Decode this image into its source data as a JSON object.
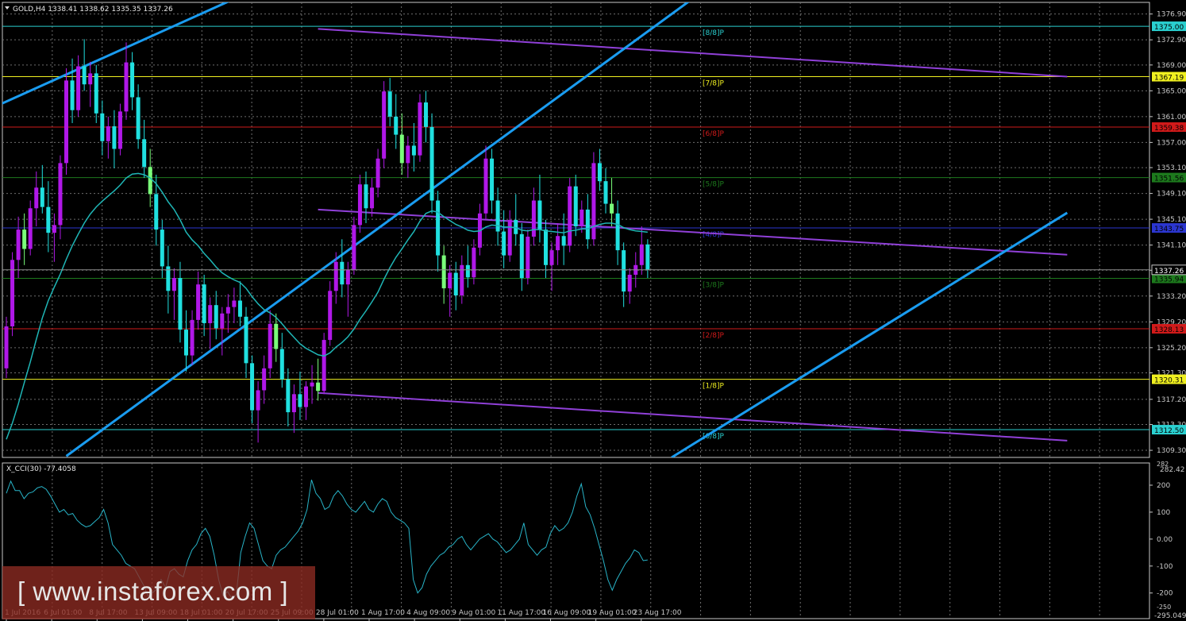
{
  "symbol_header": "GOLD,H4  1338.41 1338.62 1335.35 1337.26",
  "indicator_header": "X_CCI(30) -77.4058",
  "watermark": "[  www.instaforex.com  ]",
  "colors": {
    "background": "#000000",
    "grid": "#6e6e6e",
    "axis": "#c8c8c8",
    "bull": "#b018e8",
    "bear": "#20e0e0",
    "bear_highlight": "#7aff7a",
    "ma": "#1fb6b6",
    "trend": "#1a9cf0",
    "channel": "#9040d8",
    "cci": "#28b4c8"
  },
  "chart_data": [
    {
      "type": "candlestick",
      "symbol": "GOLD",
      "timeframe": "H4",
      "last_ohlc": {
        "open": 1338.41,
        "high": 1338.62,
        "low": 1335.35,
        "close": 1337.26
      },
      "ylim": [
        1308.2,
        1378.7
      ],
      "y_ticks": [
        "1376.90",
        "1372.90",
        "1369.00",
        "1365.00",
        "1361.00",
        "1357.00",
        "1353.10",
        "1349.10",
        "1345.10",
        "1341.10",
        "1337.20",
        "1333.20",
        "1329.20",
        "1325.20",
        "1321.30",
        "1317.20",
        "1313.30",
        "1309.30"
      ],
      "x_ticks": [
        "1 Jul 2016",
        "6 Jul 01:00",
        "8 Jul 17:00",
        "13 Jul 09:00",
        "18 Jul 01:00",
        "20 Jul 17:00",
        "25 Jul 09:00",
        "28 Jul 01:00",
        "1 Aug 17:00",
        "4 Aug 09:00",
        "9 Aug 01:00",
        "11 Aug 17:00",
        "16 Aug 09:00",
        "19 Aug 01:00",
        "23 Aug 17:00"
      ],
      "murrey_levels": [
        {
          "label": "[8/8]P",
          "value": 1375.0,
          "color": "#2ad0d0",
          "tag_text": "#000000"
        },
        {
          "label": "[7/8]P",
          "value": 1367.19,
          "color": "#f0f020",
          "tag_text": "#000000"
        },
        {
          "label": "[6/8]P",
          "value": 1359.38,
          "color": "#d01a1a",
          "tag_text": "#000000"
        },
        {
          "label": "[5/8]P",
          "value": 1351.56,
          "color": "#1d7a1d",
          "tag_text": "#000000"
        },
        {
          "label": "[4/8]P",
          "value": 1343.75,
          "color": "#2b36d0",
          "tag_text": "#000000"
        },
        {
          "label": "[3/8]P",
          "value": 1335.94,
          "color": "#1d7a1d",
          "tag_text": "#000000"
        },
        {
          "label": "[2/8]P",
          "value": 1328.13,
          "color": "#d01a1a",
          "tag_text": "#000000"
        },
        {
          "label": "[1/8]P",
          "value": 1320.31,
          "color": "#f0f020",
          "tag_text": "#000000"
        },
        {
          "label": "[0/8]P",
          "value": 1312.5,
          "color": "#2ad0d0",
          "tag_text": "#000000"
        }
      ],
      "current_price": 1337.26,
      "ma_period_note": "",
      "candles": [
        [
          1322.0,
          1330.0,
          1320.5,
          1328.5
        ],
        [
          1328.5,
          1340.0,
          1327.0,
          1338.8
        ],
        [
          1338.8,
          1345.5,
          1336.0,
          1343.5
        ],
        [
          1343.5,
          1346.0,
          1338.0,
          1340.5
        ],
        [
          1340.5,
          1348.0,
          1339.5,
          1346.8
        ],
        [
          1346.8,
          1352.5,
          1344.0,
          1350.0
        ],
        [
          1350.0,
          1353.5,
          1346.0,
          1347.0
        ],
        [
          1347.0,
          1351.0,
          1340.0,
          1343.0
        ],
        [
          1343.0,
          1346.0,
          1338.5,
          1344.2
        ],
        [
          1344.2,
          1355.0,
          1342.0,
          1353.8
        ],
        [
          1353.8,
          1368.5,
          1352.0,
          1366.6
        ],
        [
          1366.6,
          1370.0,
          1360.0,
          1362.0
        ],
        [
          1362.0,
          1370.5,
          1361.0,
          1368.8
        ],
        [
          1368.8,
          1373.0,
          1365.0,
          1366.0
        ],
        [
          1366.0,
          1369.5,
          1362.5,
          1367.7
        ],
        [
          1367.7,
          1369.0,
          1360.0,
          1361.5
        ],
        [
          1361.5,
          1363.5,
          1355.0,
          1357.2
        ],
        [
          1357.2,
          1361.0,
          1354.5,
          1359.5
        ],
        [
          1359.5,
          1362.0,
          1353.0,
          1356.0
        ],
        [
          1356.0,
          1363.0,
          1355.0,
          1361.8
        ],
        [
          1361.8,
          1372.5,
          1360.5,
          1369.4
        ],
        [
          1369.4,
          1371.0,
          1362.0,
          1364.0
        ],
        [
          1364.0,
          1366.0,
          1356.0,
          1357.5
        ],
        [
          1357.5,
          1360.5,
          1351.5,
          1353.2
        ],
        [
          1353.2,
          1356.0,
          1347.0,
          1349.0
        ],
        [
          1349.0,
          1352.0,
          1341.0,
          1343.5
        ],
        [
          1343.5,
          1345.0,
          1336.0,
          1337.8
        ],
        [
          1337.8,
          1341.0,
          1330.5,
          1334.0
        ],
        [
          1334.0,
          1337.5,
          1329.5,
          1336.0
        ],
        [
          1336.0,
          1338.5,
          1326.0,
          1328.0
        ],
        [
          1328.0,
          1331.0,
          1321.5,
          1324.0
        ],
        [
          1324.0,
          1331.0,
          1322.5,
          1329.5
        ],
        [
          1329.5,
          1337.0,
          1328.0,
          1335.0
        ],
        [
          1335.0,
          1336.5,
          1327.0,
          1329.0
        ],
        [
          1329.0,
          1333.0,
          1325.0,
          1331.8
        ],
        [
          1331.8,
          1334.0,
          1326.5,
          1328.2
        ],
        [
          1328.2,
          1331.5,
          1324.0,
          1330.5
        ],
        [
          1330.5,
          1333.5,
          1327.5,
          1331.5
        ],
        [
          1331.5,
          1334.5,
          1329.0,
          1332.5
        ],
        [
          1332.5,
          1335.5,
          1328.5,
          1330.0
        ],
        [
          1330.0,
          1331.5,
          1320.5,
          1322.8
        ],
        [
          1322.8,
          1324.0,
          1313.5,
          1315.5
        ],
        [
          1315.5,
          1320.0,
          1310.5,
          1318.6
        ],
        [
          1318.6,
          1324.0,
          1316.5,
          1322.0
        ],
        [
          1322.0,
          1331.0,
          1320.5,
          1328.9
        ],
        [
          1328.9,
          1330.5,
          1323.0,
          1325.0
        ],
        [
          1325.0,
          1327.5,
          1319.0,
          1320.3
        ],
        [
          1320.3,
          1322.0,
          1313.0,
          1315.2
        ],
        [
          1315.2,
          1319.5,
          1312.0,
          1318.0
        ],
        [
          1318.0,
          1321.5,
          1314.0,
          1316.0
        ],
        [
          1316.0,
          1320.0,
          1314.0,
          1319.2
        ],
        [
          1319.2,
          1322.5,
          1316.5,
          1319.8
        ],
        [
          1319.8,
          1323.5,
          1317.0,
          1318.5
        ],
        [
          1318.5,
          1327.5,
          1318.0,
          1326.4
        ],
        [
          1326.4,
          1335.5,
          1325.5,
          1334.0
        ],
        [
          1334.0,
          1340.0,
          1332.0,
          1338.5
        ],
        [
          1338.5,
          1342.0,
          1333.0,
          1335.0
        ],
        [
          1335.0,
          1338.5,
          1330.0,
          1337.3
        ],
        [
          1337.3,
          1345.5,
          1336.5,
          1344.2
        ],
        [
          1344.2,
          1352.0,
          1343.0,
          1350.5
        ],
        [
          1350.5,
          1352.5,
          1344.5,
          1346.8
        ],
        [
          1346.8,
          1351.5,
          1345.5,
          1350.0
        ],
        [
          1350.0,
          1356.0,
          1348.5,
          1354.5
        ],
        [
          1354.5,
          1366.5,
          1353.0,
          1364.9
        ],
        [
          1364.9,
          1367.0,
          1359.5,
          1361.0
        ],
        [
          1361.0,
          1364.5,
          1356.0,
          1358.2
        ],
        [
          1358.2,
          1361.5,
          1352.0,
          1353.8
        ],
        [
          1353.8,
          1358.0,
          1351.5,
          1356.5
        ],
        [
          1356.5,
          1360.0,
          1352.5,
          1355.0
        ],
        [
          1355.0,
          1364.5,
          1354.0,
          1363.2
        ],
        [
          1363.2,
          1365.0,
          1357.0,
          1359.4
        ],
        [
          1359.4,
          1361.5,
          1346.0,
          1348.0
        ],
        [
          1348.0,
          1349.5,
          1337.0,
          1339.5
        ],
        [
          1339.5,
          1341.0,
          1332.0,
          1334.4
        ],
        [
          1334.4,
          1338.0,
          1330.0,
          1336.8
        ],
        [
          1336.8,
          1338.5,
          1331.0,
          1333.3
        ],
        [
          1333.3,
          1339.5,
          1332.0,
          1338.0
        ],
        [
          1338.0,
          1341.0,
          1334.5,
          1336.1
        ],
        [
          1336.1,
          1342.0,
          1335.0,
          1340.7
        ],
        [
          1340.7,
          1347.5,
          1339.5,
          1346.0
        ],
        [
          1346.0,
          1356.5,
          1345.0,
          1354.5
        ],
        [
          1354.5,
          1356.0,
          1346.0,
          1348.0
        ],
        [
          1348.0,
          1350.0,
          1341.0,
          1343.2
        ],
        [
          1343.2,
          1346.5,
          1337.5,
          1339.5
        ],
        [
          1339.5,
          1346.5,
          1338.5,
          1345.0
        ],
        [
          1345.0,
          1349.0,
          1341.0,
          1342.8
        ],
        [
          1342.8,
          1344.5,
          1334.0,
          1336.0
        ],
        [
          1336.0,
          1343.5,
          1335.0,
          1342.4
        ],
        [
          1342.4,
          1350.0,
          1341.0,
          1348.0
        ],
        [
          1348.0,
          1352.0,
          1341.5,
          1343.5
        ],
        [
          1343.5,
          1345.0,
          1336.0,
          1338.0
        ],
        [
          1338.0,
          1341.5,
          1334.0,
          1340.3
        ],
        [
          1340.3,
          1344.5,
          1338.0,
          1342.5
        ],
        [
          1342.5,
          1346.0,
          1338.0,
          1341.0
        ],
        [
          1341.0,
          1351.5,
          1340.0,
          1350.2
        ],
        [
          1350.2,
          1352.0,
          1342.5,
          1344.0
        ],
        [
          1344.0,
          1348.0,
          1343.0,
          1346.6
        ],
        [
          1346.6,
          1349.0,
          1340.5,
          1342.0
        ],
        [
          1342.0,
          1355.5,
          1341.0,
          1353.8
        ],
        [
          1353.8,
          1356.0,
          1349.5,
          1351.0
        ],
        [
          1351.0,
          1353.0,
          1346.0,
          1347.5
        ],
        [
          1347.5,
          1351.5,
          1344.0,
          1346.0
        ],
        [
          1346.0,
          1348.0,
          1338.0,
          1340.3
        ],
        [
          1340.3,
          1341.5,
          1331.5,
          1333.9
        ],
        [
          1333.9,
          1337.5,
          1332.0,
          1336.5
        ],
        [
          1336.5,
          1340.0,
          1334.5,
          1338.0
        ],
        [
          1338.0,
          1344.0,
          1336.5,
          1341.2
        ],
        [
          1341.2,
          1342.0,
          1336.0,
          1337.26
        ]
      ],
      "ma_values": [
        1311.0,
        1313.5,
        1316.5,
        1319.8,
        1323.0,
        1326.5,
        1329.8,
        1332.5,
        1334.6,
        1336.6,
        1338.9,
        1341.0,
        1342.8,
        1344.5,
        1345.9,
        1347.0,
        1347.9,
        1348.7,
        1349.5,
        1350.4,
        1351.5,
        1352.1,
        1352.2,
        1352.0,
        1351.5,
        1350.6,
        1349.3,
        1347.8,
        1346.6,
        1345.0,
        1343.1,
        1341.9,
        1341.0,
        1339.8,
        1338.8,
        1337.7,
        1336.8,
        1336.2,
        1335.7,
        1335.3,
        1334.4,
        1333.1,
        1332.0,
        1331.1,
        1330.6,
        1329.9,
        1328.9,
        1327.8,
        1326.8,
        1325.8,
        1325.1,
        1324.6,
        1324.1,
        1323.9,
        1324.4,
        1325.3,
        1326.0,
        1326.9,
        1328.1,
        1329.6,
        1330.9,
        1332.3,
        1333.8,
        1335.8,
        1337.6,
        1339.2,
        1340.5,
        1341.9,
        1343.2,
        1344.8,
        1346.0,
        1346.4,
        1346.2,
        1345.5,
        1344.9,
        1344.3,
        1343.9,
        1343.4,
        1343.2,
        1343.3,
        1343.9,
        1344.2,
        1344.1,
        1343.9,
        1343.9,
        1343.8,
        1343.4,
        1343.3,
        1343.5,
        1343.5,
        1343.3,
        1343.2,
        1343.1,
        1343.0,
        1343.3,
        1343.4,
        1343.6,
        1343.6,
        1344.0,
        1344.3,
        1344.5,
        1344.5,
        1344.3,
        1343.8,
        1343.5,
        1343.3,
        1343.2,
        1343.1
      ],
      "trend_lines": [
        {
          "from": [
            -2,
            1362.5
          ],
          "to": [
            47,
            1383.0
          ],
          "color": "#1a9cf0"
        },
        {
          "from": [
            10,
            1308.4
          ],
          "to": [
            120,
            1383.0
          ],
          "color": "#1a9cf0"
        },
        {
          "from": [
            111,
            1308.2
          ],
          "to": [
            177,
            1346.1
          ],
          "color": "#1a9cf0"
        }
      ],
      "channel_lines": [
        {
          "from": [
            52,
            1374.6
          ],
          "to": [
            177,
            1367.2
          ],
          "color": "#9040d8"
        },
        {
          "from": [
            52,
            1346.6
          ],
          "to": [
            177,
            1339.6
          ],
          "color": "#9040d8"
        },
        {
          "from": [
            52,
            1318.2
          ],
          "to": [
            177,
            1310.8
          ],
          "color": "#9040d8"
        }
      ]
    },
    {
      "type": "line",
      "name": "X_CCI(30)",
      "last_value": -77.4058,
      "ylim": [
        -295.049,
        282.42
      ],
      "scale_labels_top": [
        "282.42"
      ],
      "y_ticks": [
        "200",
        "100",
        "0.00",
        "-100",
        "-200"
      ],
      "scale_label_bottom": "-295.049",
      "tick_extra_top": "282",
      "tick_extra_bottom": "-250",
      "values": [
        170,
        215,
        180,
        180,
        150,
        170,
        175,
        190,
        195,
        185,
        160,
        130,
        100,
        110,
        90,
        95,
        70,
        55,
        45,
        50,
        65,
        80,
        110,
        60,
        -20,
        -40,
        -60,
        -90,
        -100,
        -110,
        -140,
        -170,
        -210,
        -200,
        -185,
        -150,
        -180,
        -120,
        -110,
        -130,
        -140,
        -80,
        -40,
        -20,
        20,
        40,
        10,
        -60,
        -150,
        -210,
        -195,
        -220,
        -205,
        -50,
        10,
        60,
        40,
        -20,
        -80,
        -100,
        -110,
        -60,
        -40,
        -30,
        -10,
        10,
        30,
        60,
        110,
        220,
        170,
        150,
        110,
        120,
        160,
        180,
        160,
        130,
        110,
        100,
        120,
        140,
        110,
        100,
        130,
        150,
        140,
        100,
        80,
        70,
        60,
        40,
        -150,
        -200,
        -180,
        -130,
        -100,
        -80,
        -60,
        -50,
        -30,
        -20,
        0,
        10,
        -20,
        -40,
        -20,
        0,
        10,
        20,
        0,
        -10,
        -30,
        -50,
        -40,
        -20,
        0,
        60,
        -20,
        -40,
        -60,
        -40,
        -30,
        20,
        50,
        30,
        40,
        60,
        100,
        160,
        205,
        120,
        90,
        40,
        -20,
        -80,
        -150,
        -190,
        -150,
        -120,
        -90,
        -70,
        -40,
        -50,
        -80,
        -77.4058
      ]
    }
  ]
}
